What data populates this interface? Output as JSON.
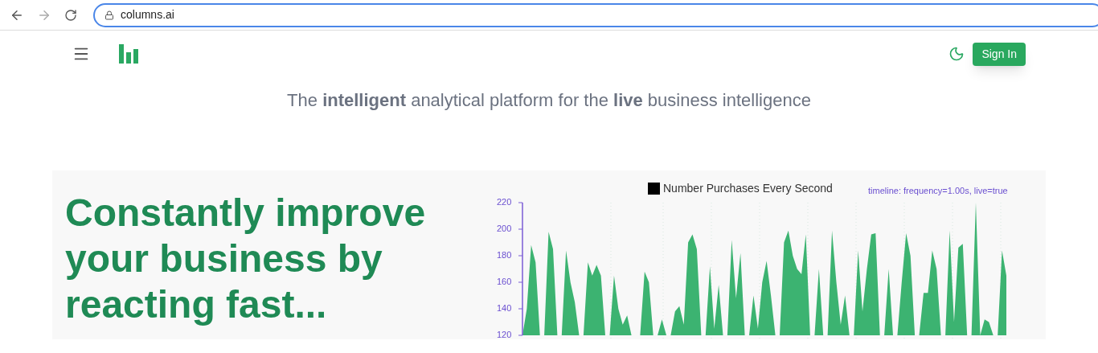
{
  "browser": {
    "url": "columns.ai"
  },
  "nav": {
    "button": "Sign In"
  },
  "tagline": "The **intelligent** analytical platform for the **live** business intelligence",
  "hero": {
    "heading": "Constantly improve your business by reacting fast...",
    "legend": {
      "color": "#000000"
    },
    "chart_data": {
      "type": "area",
      "ylim": [
        120,
        220
      ],
      "yticks": [
        120,
        140,
        160,
        180,
        200,
        220
      ],
      "annotations": [
        "timeline: frequency=1.00s, live=true"
      ],
      "categories": [
        null,
        null,
        null,
        null,
        null,
        null,
        null,
        null,
        null,
        null,
        null,
        null,
        null,
        null,
        null,
        null,
        null,
        null,
        null,
        null,
        null,
        null,
        null,
        null,
        null,
        null,
        null,
        null,
        null,
        null,
        null,
        null,
        null,
        null,
        null,
        null,
        null,
        null,
        null,
        null,
        null,
        null,
        null,
        null,
        null,
        null,
        null,
        null,
        null,
        null,
        null,
        null,
        null,
        null,
        null,
        null,
        null,
        null,
        null,
        null,
        null,
        null,
        null,
        null,
        null,
        null,
        null,
        null,
        null,
        null,
        null,
        null,
        null,
        null,
        null,
        null,
        null,
        null,
        null,
        null,
        null,
        null,
        null,
        null,
        null,
        null,
        null,
        null,
        null,
        null,
        null,
        null,
        null,
        null,
        null,
        null,
        null,
        null,
        null,
        null,
        null,
        null,
        null,
        null,
        null,
        null,
        null,
        null,
        null,
        null,
        null,
        null
      ],
      "series": [
        {
          "name": "Number Purchases Every Second",
          "color": "#3cb371",
          "values": [
            120,
            140,
            188,
            175,
            120,
            120,
            198,
            185,
            120,
            120,
            184,
            160,
            145,
            120,
            120,
            175,
            165,
            173,
            165,
            120,
            120,
            165,
            140,
            128,
            135,
            120,
            120,
            120,
            168,
            160,
            120,
            120,
            132,
            120,
            120,
            138,
            142,
            128,
            190,
            196,
            185,
            120,
            120,
            172,
            125,
            158,
            120,
            120,
            192,
            148,
            182,
            120,
            120,
            150,
            125,
            160,
            176,
            150,
            120,
            120,
            190,
            199,
            180,
            170,
            166,
            196,
            120,
            120,
            170,
            120,
            120,
            199,
            160,
            128,
            150,
            120,
            120,
            184,
            138,
            170,
            196,
            197,
            120,
            120,
            170,
            120,
            120,
            160,
            197,
            180,
            120,
            120,
            152,
            152,
            184,
            170,
            120,
            120,
            199,
            130,
            186,
            189,
            120,
            120,
            220,
            120,
            132,
            130,
            120,
            120,
            184,
            165
          ]
        }
      ]
    }
  }
}
